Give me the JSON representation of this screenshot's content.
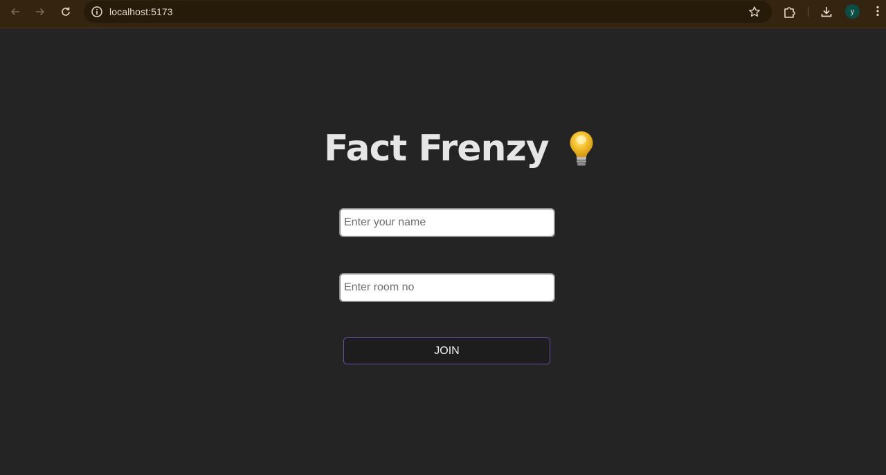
{
  "browser": {
    "url": "localhost:5173",
    "profile_initial": "y",
    "icons": {
      "back": "back-arrow-icon",
      "forward": "forward-arrow-icon",
      "reload": "reload-icon",
      "site_info": "info-icon",
      "bookmark": "star-icon",
      "extensions": "puzzle-icon",
      "downloads": "download-icon",
      "menu": "kebab-menu-icon"
    }
  },
  "page": {
    "title": "Fact Frenzy",
    "title_icon": "lightbulb-icon",
    "name_placeholder": "Enter your name",
    "name_value": "",
    "room_placeholder": "Enter room no",
    "room_value": "",
    "join_label": "JOIN"
  },
  "colors": {
    "background": "#242424",
    "title": "#e6e6e6",
    "button_border": "#6b4fa8",
    "avatar": "#0b4d44"
  }
}
